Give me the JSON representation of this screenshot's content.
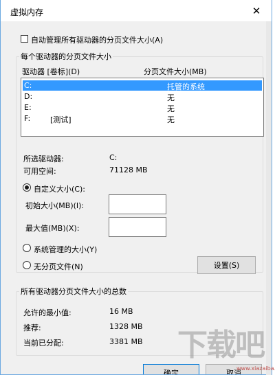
{
  "window": {
    "title": "虚拟内存",
    "close_label": "✕"
  },
  "auto_manage": {
    "label": "自动管理所有驱动器的分页文件大小(A)",
    "checked": false
  },
  "drives_group": {
    "title": "每个驱动器的分页文件大小",
    "col_drive": "驱动器 [卷标](D)",
    "col_size": "分页文件大小(MB)",
    "rows": [
      {
        "drive": "C:",
        "label": "",
        "size": "托管的系统",
        "selected": true
      },
      {
        "drive": "D:",
        "label": "",
        "size": "无",
        "selected": false
      },
      {
        "drive": "E:",
        "label": "",
        "size": "无",
        "selected": false
      },
      {
        "drive": "F:",
        "label": "[测试]",
        "size": "无",
        "selected": false
      }
    ],
    "selected_drive_label": "所选驱动器:",
    "selected_drive_value": "C:",
    "free_space_label": "可用空间:",
    "free_space_value": "71128 MB",
    "custom_size_label": "自定义大小(C):",
    "initial_size_label": "初始大小(MB)(I):",
    "initial_size_value": "",
    "max_size_label": "最大值(MB)(X):",
    "max_size_value": "",
    "system_managed_label": "系统管理的大小(Y)",
    "no_paging_label": "无分页文件(N)",
    "set_button": "设置(S)",
    "selected_option": "custom"
  },
  "total_group": {
    "title": "所有驱动器分页文件大小的总数",
    "min_label": "允许的最小值:",
    "min_value": "16 MB",
    "recommended_label": "推荐:",
    "recommended_value": "1328 MB",
    "current_label": "当前已分配:",
    "current_value": "3381 MB"
  },
  "footer": {
    "ok_button": "确定",
    "cancel_button": "取消"
  },
  "watermark": {
    "text": "下载吧",
    "url": "www.xiazaiba.com"
  }
}
